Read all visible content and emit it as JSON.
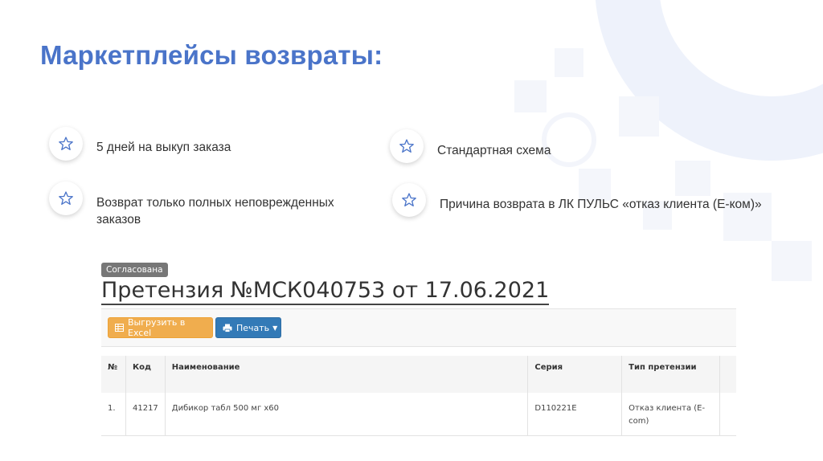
{
  "title": "Маркетплейсы возвраты:",
  "bullets": [
    {
      "text": "5 дней на выкуп заказа",
      "icon": "star-icon"
    },
    {
      "text": "Возврат только полных неповрежденных заказов",
      "icon": "star-icon"
    },
    {
      "text": "Стандартная схема",
      "icon": "star-icon"
    },
    {
      "text": "Причина возврата в ЛК ПУЛЬС «отказ клиента (Е-ком)»",
      "icon": "star-icon"
    }
  ],
  "claim": {
    "status": "Согласована",
    "title": "Претензия №МСК040753 от 17.06.2021"
  },
  "toolbar": {
    "excel_label": "Выгрузить в Excel",
    "print_label": "Печать"
  },
  "table": {
    "headers": {
      "num": "№",
      "code": "Код",
      "name": "Наименование",
      "series": "Серия",
      "type": "Тип претензии"
    },
    "rows": [
      {
        "num": "1.",
        "code": "41217",
        "name": "Дибикор табл 500 мг х60",
        "series": "D110221E",
        "type": "Отказ клиента (Е-com)"
      }
    ]
  },
  "colors": {
    "title": "#4a74c9",
    "star": "#4a74c9",
    "excel_button": "#f0ad4e",
    "print_button": "#337ab7",
    "badge": "#777777"
  }
}
